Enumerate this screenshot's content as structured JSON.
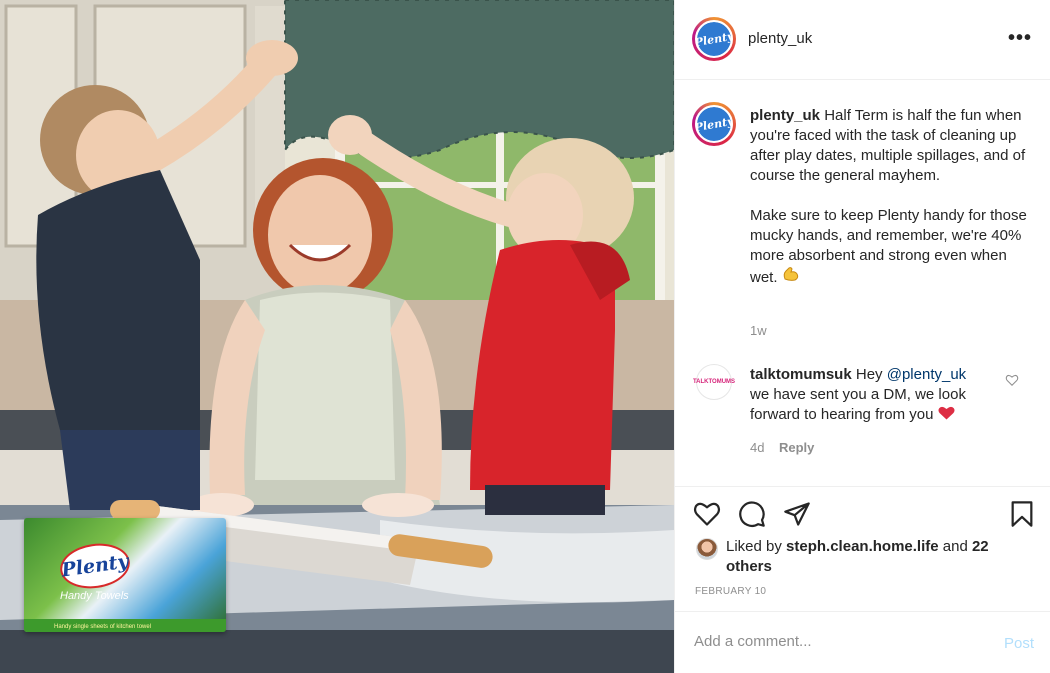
{
  "post": {
    "username": "plenty_uk",
    "brand_logo_text": "Plenty",
    "more_icon": "ellipsis-icon",
    "caption": {
      "username": "plenty_uk",
      "paragraph1": "Half Term is half the fun when you're faced with the task of cleaning up after play dates, multiple spillages, and of course the general mayhem.",
      "paragraph2": "Make sure to keep Plenty handy for those mucky hands, and remember, we're 40% more absorbent and strong even when wet.",
      "emoji": "flexed-biceps-emoji",
      "age": "1w"
    },
    "comment": {
      "avatar_text": "TALKTOMUMS",
      "username": "talktomumsuk",
      "prefix": "Hey",
      "mention": "@plenty_uk",
      "text": "we have sent you a DM, we look forward to hearing from you",
      "emoji": "red-heart-emoji",
      "age": "4d",
      "reply_label": "Reply",
      "like_icon": "heart-outline-icon"
    },
    "actions": {
      "like_icon": "heart-outline-icon",
      "comment_icon": "comment-bubble-icon",
      "share_icon": "paper-plane-icon",
      "save_icon": "bookmark-icon"
    },
    "likes": {
      "prefix": "Liked by",
      "user": "steph.clean.home.life",
      "and": "and",
      "others": "22 others"
    },
    "date": "FEBRUARY 10",
    "add_comment": {
      "placeholder": "Add a comment...",
      "post_label": "Post"
    },
    "product": {
      "brand": "Plenty",
      "name": "Handy Towels",
      "tagline": "Handy single sheets of kitchen towel"
    }
  },
  "colors": {
    "text": "#262626",
    "secondary": "#8e8e8e",
    "link": "#00376b",
    "post_disabled": "#b2dffc",
    "heart": "#ed4956",
    "divider": "#efefef"
  }
}
